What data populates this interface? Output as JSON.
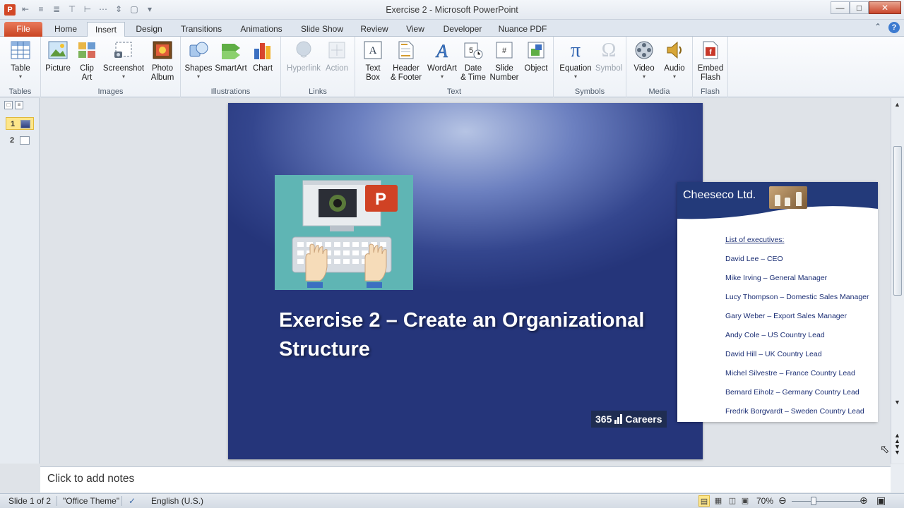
{
  "window": {
    "title": "Exercise 2  -  Microsoft PowerPoint",
    "minimize_icon": "minimize-icon",
    "maximize_icon": "maximize-icon",
    "close_icon": "close-icon"
  },
  "quick_access": [
    "align-left-icon",
    "align-center-icon",
    "align-distribute-icon",
    "align-top-icon",
    "align-middle-icon",
    "distribute-icon",
    "arrange-icon",
    "group-icon",
    "customize-qat-icon"
  ],
  "tabs": [
    {
      "label": "File"
    },
    {
      "label": "Home"
    },
    {
      "label": "Insert",
      "active": true
    },
    {
      "label": "Design"
    },
    {
      "label": "Transitions"
    },
    {
      "label": "Animations"
    },
    {
      "label": "Slide Show"
    },
    {
      "label": "Review"
    },
    {
      "label": "View"
    },
    {
      "label": "Developer"
    },
    {
      "label": "Nuance PDF"
    }
  ],
  "ribbon": {
    "groups": {
      "tables": "Tables",
      "images": "Images",
      "illustrations": "Illustrations",
      "links": "Links",
      "text": "Text",
      "symbols": "Symbols",
      "media": "Media",
      "flash": "Flash"
    },
    "buttons": {
      "table": "Table",
      "picture": "Picture",
      "clip_art_1": "Clip",
      "clip_art_2": "Art",
      "screenshot": "Screenshot",
      "photo_album_1": "Photo",
      "photo_album_2": "Album",
      "shapes": "Shapes",
      "smartart": "SmartArt",
      "chart": "Chart",
      "hyperlink": "Hyperlink",
      "action": "Action",
      "text_box_1": "Text",
      "text_box_2": "Box",
      "header_footer_1": "Header",
      "header_footer_2": "& Footer",
      "wordart": "WordArt",
      "date_time_1": "Date",
      "date_time_2": "& Time",
      "slide_number_1": "Slide",
      "slide_number_2": "Number",
      "object": "Object",
      "equation": "Equation",
      "symbol": "Symbol",
      "video": "Video",
      "audio": "Audio",
      "embed_flash_1": "Embed",
      "embed_flash_2": "Flash"
    }
  },
  "slides_panel": {
    "items": [
      {
        "number": "1",
        "selected": true
      },
      {
        "number": "2",
        "selected": false
      }
    ]
  },
  "slide": {
    "title_line1": "Exercise 2 – Create an Organizational",
    "title_line2": "Structure",
    "brand_number": "365",
    "brand_name": "Careers"
  },
  "card": {
    "company": "Cheeseco Ltd.",
    "list_heading": "List of executives:",
    "executives": [
      "David Lee – CEO",
      "Mike Irving – General Manager",
      "Lucy Thompson – Domestic Sales Manager",
      "Gary Weber – Export Sales Manager",
      "Andy Cole – US Country Lead",
      "David Hill – UK Country Lead",
      "Michel Silvestre – France Country Lead",
      "Bernard Eiholz – Germany Country Lead",
      "Fredrik Borgvardt – Sweden Country Lead"
    ]
  },
  "notes": {
    "placeholder": "Click to add notes"
  },
  "status": {
    "slide_info": "Slide 1 of 2",
    "theme": "\"Office Theme\"",
    "language": "English (U.S.)",
    "zoom": "70%"
  },
  "colors": {
    "accent_file_tab": "#c94422",
    "slide_background": "#34468e",
    "card_header": "#233a7a",
    "brand_badge": "#1f2d52"
  }
}
